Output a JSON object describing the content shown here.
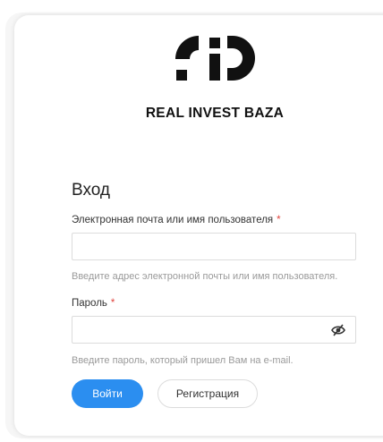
{
  "brand": {
    "name": "REAL INVEST BAZA",
    "logo_icon": "rib-logo-icon"
  },
  "login": {
    "title": "Вход",
    "username": {
      "label": "Электронная почта или имя пользователя",
      "required_mark": "*",
      "value": "",
      "hint": "Введите адрес электронной почты или имя пользователя."
    },
    "password": {
      "label": "Пароль",
      "required_mark": "*",
      "value": "",
      "toggle_icon": "eye-slash-icon",
      "hint": "Введите пароль, который пришел Вам на e-mail."
    },
    "submit_label": "Войти",
    "register_label": "Регистрация"
  },
  "colors": {
    "primary": "#2b8ef0",
    "required": "#e0443e",
    "hint": "#9a9a9a"
  }
}
